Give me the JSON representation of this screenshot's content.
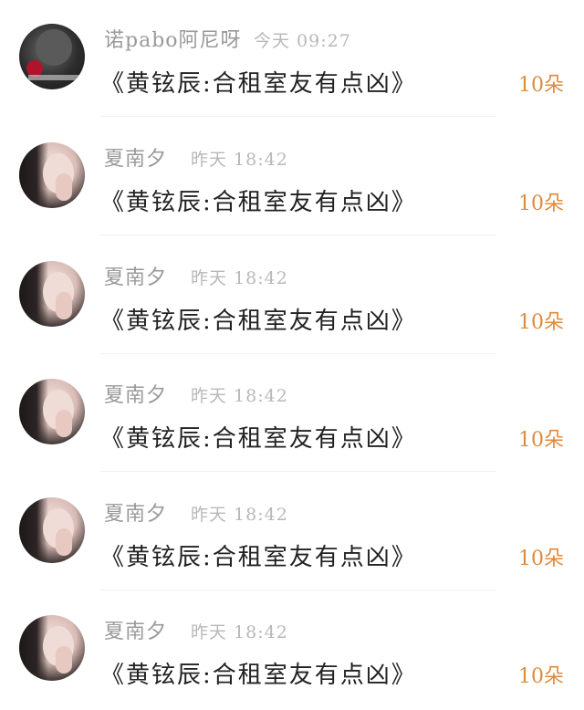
{
  "comments": [
    {
      "username": "诺pabo阿尼呀",
      "time": "今天 09:27",
      "message": "《黄铉辰:合租室友有点凶》",
      "flowers": "10朵",
      "avatar": "avatar-dark-rose"
    },
    {
      "username": "夏南夕",
      "time": "昨天 18:42",
      "message": "《黄铉辰:合租室友有点凶》",
      "flowers": "10朵",
      "avatar": "avatar-girl"
    },
    {
      "username": "夏南夕",
      "time": "昨天 18:42",
      "message": "《黄铉辰:合租室友有点凶》",
      "flowers": "10朵",
      "avatar": "avatar-girl"
    },
    {
      "username": "夏南夕",
      "time": "昨天 18:42",
      "message": "《黄铉辰:合租室友有点凶》",
      "flowers": "10朵",
      "avatar": "avatar-girl"
    },
    {
      "username": "夏南夕",
      "time": "昨天 18:42",
      "message": "《黄铉辰:合租室友有点凶》",
      "flowers": "10朵",
      "avatar": "avatar-girl"
    },
    {
      "username": "夏南夕",
      "time": "昨天 18:42",
      "message": "《黄铉辰:合租室友有点凶》",
      "flowers": "10朵",
      "avatar": "avatar-girl"
    }
  ],
  "colors": {
    "username": "#9a9a9a",
    "time": "#b8b8b8",
    "message": "#222222",
    "flowers": "#e08a3c",
    "background": "#ffffff"
  }
}
